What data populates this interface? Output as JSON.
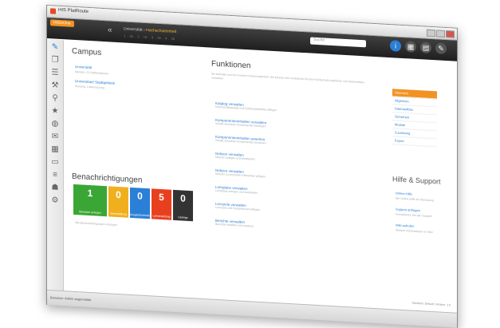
{
  "window": {
    "title": "HIS PlatRoute"
  },
  "toolbar": {
    "brand": "HISinOne",
    "back": "«",
    "breadcrumb_1": "Universität",
    "breadcrumb_sep": "›",
    "breadcrumb_2": "Hochschuleinheit",
    "breadcrumb_sub": "1 . ID . 2 . ID . 3 . ID . 4 . ID",
    "search_placeholder": "Suche",
    "icons": [
      {
        "name": "info-icon",
        "glyph": "i",
        "color": "#2a7fd6"
      },
      {
        "name": "org-chart-icon",
        "glyph": "▦",
        "color": "#555555"
      },
      {
        "name": "print-icon",
        "glyph": "▤",
        "color": "#555555"
      },
      {
        "name": "edit-icon",
        "glyph": "✎",
        "color": "#555555"
      }
    ]
  },
  "sidebar": {
    "icons": [
      "pencil-icon",
      "copy-icon",
      "layers-icon",
      "wrench-icon",
      "search-icon",
      "star-icon",
      "globe-icon",
      "chat-icon",
      "calendar-icon",
      "window-icon",
      "list-icon",
      "users-icon",
      "gear-icon"
    ],
    "glyphs": [
      "✎",
      "❐",
      "☰",
      "⚒",
      "⚲",
      "★",
      "◍",
      "✉",
      "▦",
      "▭",
      "≡",
      "☗",
      "⚙"
    ]
  },
  "campus": {
    "title": "Campus",
    "links": [
      {
        "label": "Universität",
        "sub": "Mensen, 23 Stellfunktionen"
      },
      {
        "label": "Universitaet Stadtgebiete",
        "sub": "Nutzung, Liniennutzung"
      }
    ]
  },
  "notifications": {
    "title": "Benachrichtigungen",
    "tiles": [
      {
        "count": "1",
        "label": "Benutzer anlegen",
        "color": "#3aa635"
      },
      {
        "count": "0",
        "label": "Veranstaltung",
        "color": "#f0b01e"
      },
      {
        "count": "0",
        "label": "Ausgleichsbedarf",
        "color": "#2a7fd6"
      },
      {
        "count": "5",
        "label": "Lernerstellung",
        "color": "#e8401f"
      },
      {
        "count": "0",
        "label": "Uebrige",
        "color": "#333333"
      }
    ],
    "link": "Alle Benachrichtigungen anzeigen"
  },
  "functions": {
    "title": "Funktionen",
    "intro": "Sie befinden sich im Kontext Hochschuleinheit. Sie können hier Funktionen für Ihre Hochschule ausführen und Stammdaten verwalten.",
    "items": [
      {
        "label": "Katalog verwalten",
        "sub": "Hochschulkataloge und Schlüsseltabellen pflegen"
      },
      {
        "label": "Komponenteninhalten verwalten",
        "sub": "Inhalte einzelner Komponenten festlegen"
      },
      {
        "label": "Komponenteninhalten ansehen",
        "sub": "Inhalte einzelner Komponenten einsehen"
      },
      {
        "label": "Notizen verwalten",
        "sub": "Notizen anlegen und bearbeiten"
      },
      {
        "label": "Notizen verwalten",
        "sub": "Notizen zu einzelnen Elementen pflegen"
      },
      {
        "label": "Lehrpläne verwalten",
        "sub": "Lehrpläne anlegen und bearbeiten"
      },
      {
        "label": "Lernziele verwalten",
        "sub": "Lernziele und Kompetenzen pflegen"
      },
      {
        "label": "Berichte verwalten",
        "sub": "Berichte erstellen und ansehen"
      }
    ]
  },
  "rightnav": {
    "items": [
      "Übersicht",
      "Allgemein",
      "Datenaufbau",
      "Sicherheit",
      "Module",
      "Zuordnung",
      "Export"
    ],
    "active": 0
  },
  "help": {
    "title": "Hilfe & Support",
    "links": [
      {
        "label": "Online-Hilfe",
        "sub": "Die Online-Hilfe zur Benutzung"
      },
      {
        "label": "Support anfragen",
        "sub": "Kontaktieren Sie den Support"
      },
      {
        "label": "Wiki aufrufen",
        "sub": "Weitere Informationen im Wiki"
      }
    ]
  },
  "status": {
    "left": "Benutzer: Admin angemeldet",
    "right": "Mandant: Default | Version: 1.0"
  }
}
